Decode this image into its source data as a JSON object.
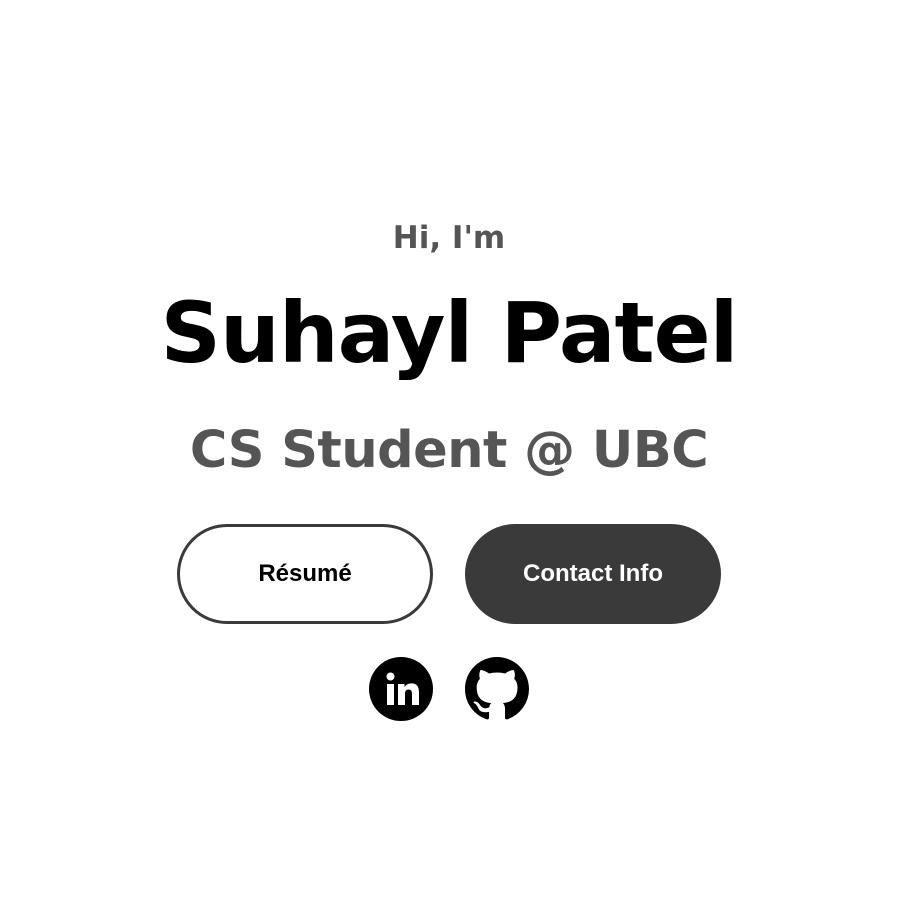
{
  "hero": {
    "greeting": "Hi, I'm",
    "name": "Suhayl Patel",
    "subtitle": "CS Student @ UBC"
  },
  "buttons": {
    "resume_label": "Résumé",
    "contact_label": "Contact Info"
  },
  "social": [
    {
      "icon": "linkedin-icon"
    },
    {
      "icon": "github-icon"
    }
  ],
  "colors": {
    "background": "#ffffff",
    "heading": "#000000",
    "muted_text": "#555555",
    "button_dark": "#3a3a3a"
  }
}
